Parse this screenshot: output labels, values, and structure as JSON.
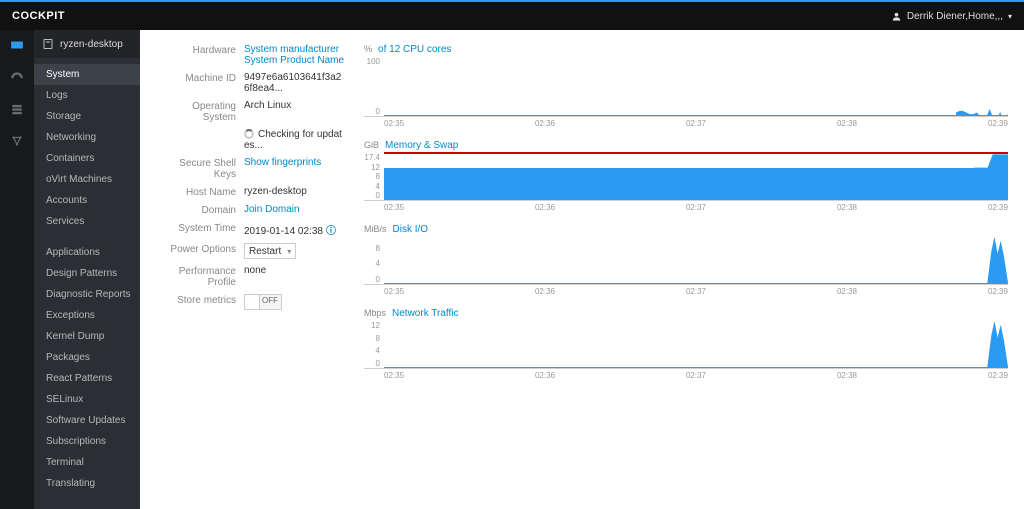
{
  "brand": "COCKPIT",
  "user": {
    "name": "Derrik Diener,Home,,,",
    "icon": "user-icon"
  },
  "host": "ryzen-desktop",
  "nav": [
    {
      "label": "System",
      "active": true
    },
    {
      "label": "Logs"
    },
    {
      "label": "Storage"
    },
    {
      "label": "Networking"
    },
    {
      "label": "Containers"
    },
    {
      "label": "oVirt Machines"
    },
    {
      "label": "Accounts"
    },
    {
      "label": "Services"
    },
    {
      "label": "Applications"
    },
    {
      "label": "Design Patterns"
    },
    {
      "label": "Diagnostic Reports"
    },
    {
      "label": "Exceptions"
    },
    {
      "label": "Kernel Dump"
    },
    {
      "label": "Packages"
    },
    {
      "label": "React Patterns"
    },
    {
      "label": "SELinux"
    },
    {
      "label": "Software Updates"
    },
    {
      "label": "Subscriptions"
    },
    {
      "label": "Terminal"
    },
    {
      "label": "Translating"
    }
  ],
  "info": {
    "hardware_label": "Hardware",
    "hardware_value": "System manufacturer System Product Name",
    "machineid_label": "Machine ID",
    "machineid_value": "9497e6a6103641f3a26f8ea4...",
    "os_label": "Operating System",
    "os_value": "Arch Linux",
    "updates": "Checking for updates...",
    "ssh_label": "Secure Shell Keys",
    "ssh_value": "Show fingerprints",
    "hostname_label": "Host Name",
    "hostname_value": "ryzen-desktop",
    "domain_label": "Domain",
    "domain_value": "Join Domain",
    "systime_label": "System Time",
    "systime_value": "2019-01-14 02:38",
    "power_label": "Power Options",
    "power_value": "Restart",
    "perf_label": "Performance Profile",
    "perf_value": "none",
    "metrics_label": "Store metrics",
    "metrics_value": "OFF"
  },
  "xticks": [
    "02:35",
    "02:36",
    "02:37",
    "02:38",
    "02:39"
  ],
  "chart_data": [
    {
      "type": "area",
      "title": "of 12 CPU cores",
      "unit": "%",
      "ylim": [
        0,
        100
      ],
      "yticks": [
        "100",
        "",
        "0"
      ],
      "series": [
        {
          "name": "cpu",
          "values_flat": 1,
          "spike_peak": 12
        }
      ]
    },
    {
      "type": "area",
      "title": "Memory & Swap",
      "unit": "GiB",
      "ylim": [
        0,
        17.4
      ],
      "yticks": [
        "17.4",
        "12",
        "8",
        "4",
        "0"
      ],
      "series": [
        {
          "name": "memory",
          "baseline": 12.0,
          "spike_peak": 17.0
        },
        {
          "name": "swap",
          "baseline": 17.0,
          "color": "#cc0000"
        }
      ]
    },
    {
      "type": "area",
      "title": "Disk I/O",
      "unit": "MiB/s",
      "ylim": [
        0,
        10
      ],
      "yticks": [
        "",
        "8",
        "4",
        "0"
      ],
      "series": [
        {
          "name": "disk",
          "values_flat": 0,
          "spike_peak": 10
        }
      ]
    },
    {
      "type": "area",
      "title": "Network Traffic",
      "unit": "Mbps",
      "ylim": [
        0,
        12
      ],
      "yticks": [
        "12",
        "8",
        "4",
        "0"
      ],
      "series": [
        {
          "name": "net",
          "values_flat": 0,
          "spike_peak": 12
        }
      ]
    }
  ]
}
